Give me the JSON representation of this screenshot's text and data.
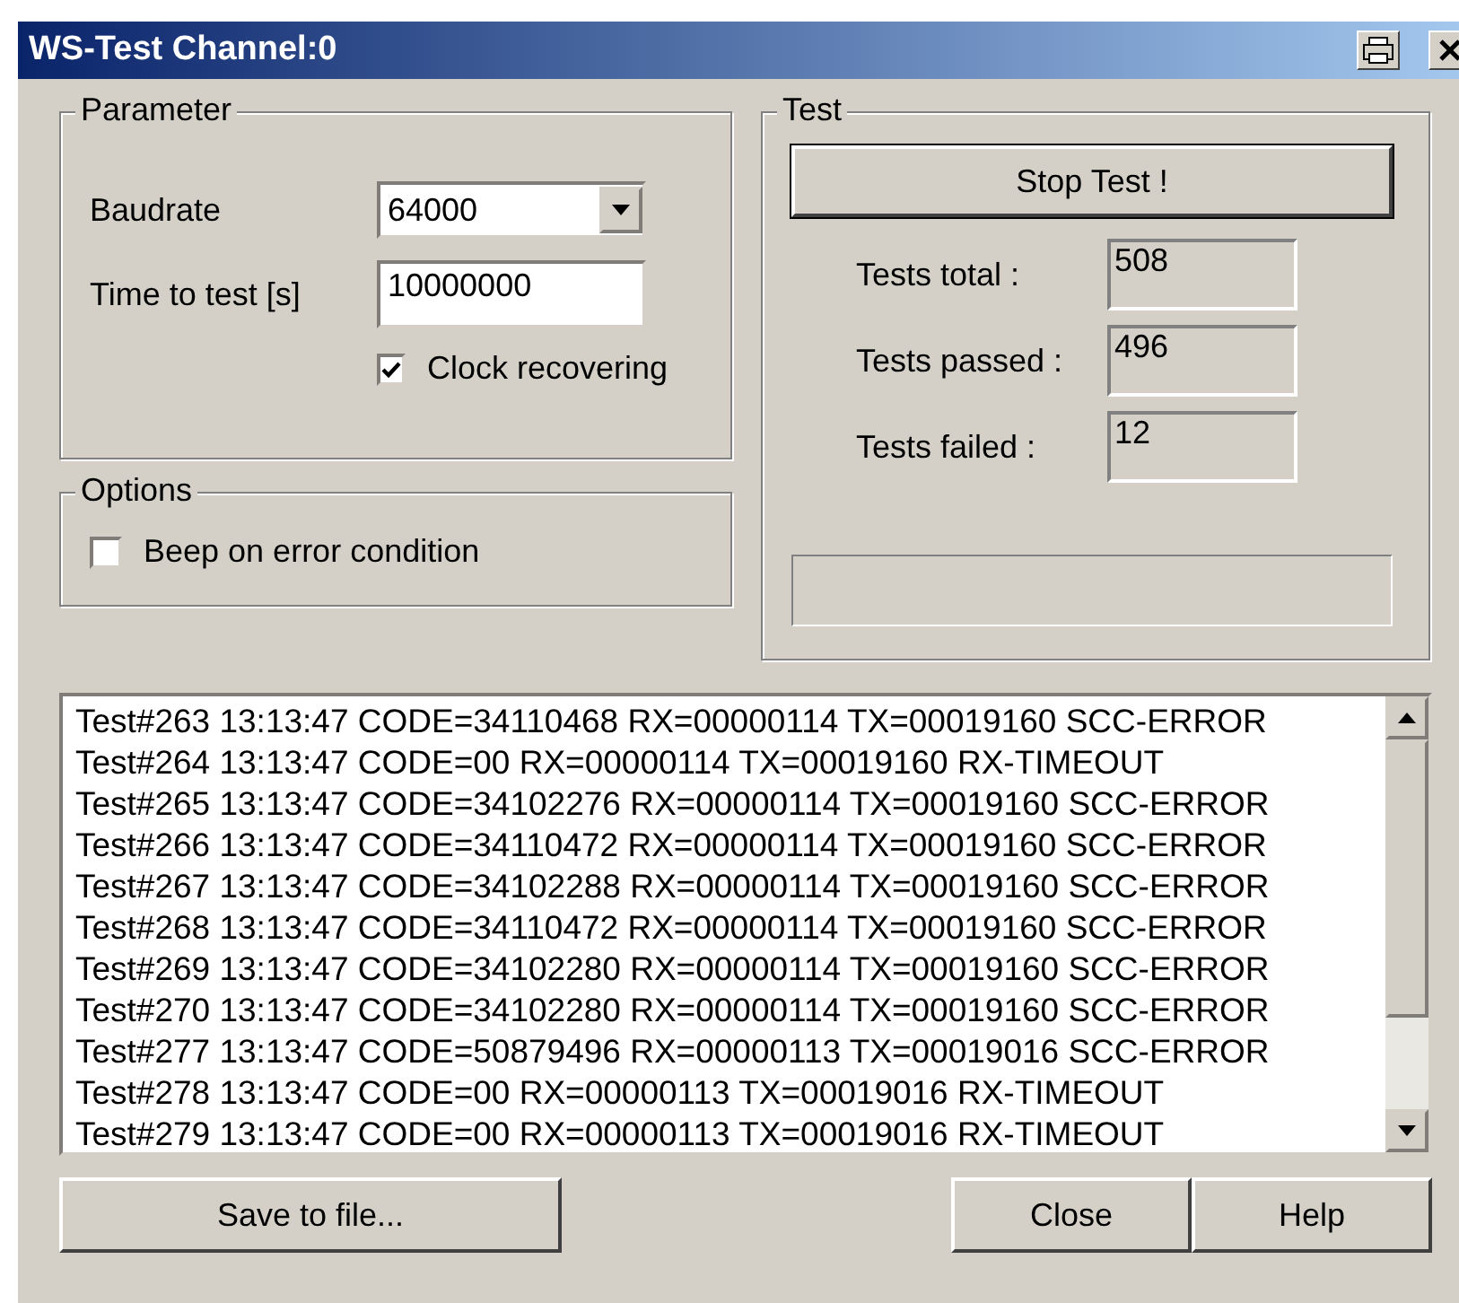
{
  "window": {
    "title": "WS-Test Channel:0"
  },
  "parameter": {
    "title": "Parameter",
    "baudrate_label": "Baudrate",
    "baudrate_value": "64000",
    "time_label": "Time to test [s]",
    "time_value": "10000000",
    "clock": {
      "label": "Clock recovering",
      "checked": true
    }
  },
  "options": {
    "title": "Options",
    "beep": {
      "label": "Beep on error condition",
      "checked": false
    }
  },
  "test": {
    "title": "Test",
    "button": "Stop Test !",
    "stats": [
      {
        "label": "Tests total :",
        "value": "508"
      },
      {
        "label": "Tests passed :",
        "value": "496"
      },
      {
        "label": "Tests failed :",
        "value": "12"
      }
    ],
    "progress": {
      "level": 0
    }
  },
  "log": [
    "Test#263 13:13:47 CODE=34110468 RX=00000114 TX=00019160 SCC-ERROR",
    "Test#264 13:13:47 CODE=00 RX=00000114 TX=00019160 RX-TIMEOUT",
    "Test#265 13:13:47 CODE=34102276 RX=00000114 TX=00019160 SCC-ERROR",
    "Test#266 13:13:47 CODE=34110472 RX=00000114 TX=00019160 SCC-ERROR",
    "Test#267 13:13:47 CODE=34102288 RX=00000114 TX=00019160 SCC-ERROR",
    "Test#268 13:13:47 CODE=34110472 RX=00000114 TX=00019160 SCC-ERROR",
    "Test#269 13:13:47 CODE=34102280 RX=00000114 TX=00019160 SCC-ERROR",
    "Test#270 13:13:47 CODE=34102280 RX=00000114 TX=00019160 SCC-ERROR",
    "Test#277 13:13:47 CODE=50879496 RX=00000113 TX=00019016 SCC-ERROR",
    "Test#278 13:13:47 CODE=00 RX=00000113 TX=00019016 RX-TIMEOUT",
    "Test#279 13:13:47 CODE=00 RX=00000113 TX=00019016 RX-TIMEOUT"
  ],
  "buttons": {
    "save": "Save to file...",
    "close": "Close",
    "help": "Help"
  }
}
